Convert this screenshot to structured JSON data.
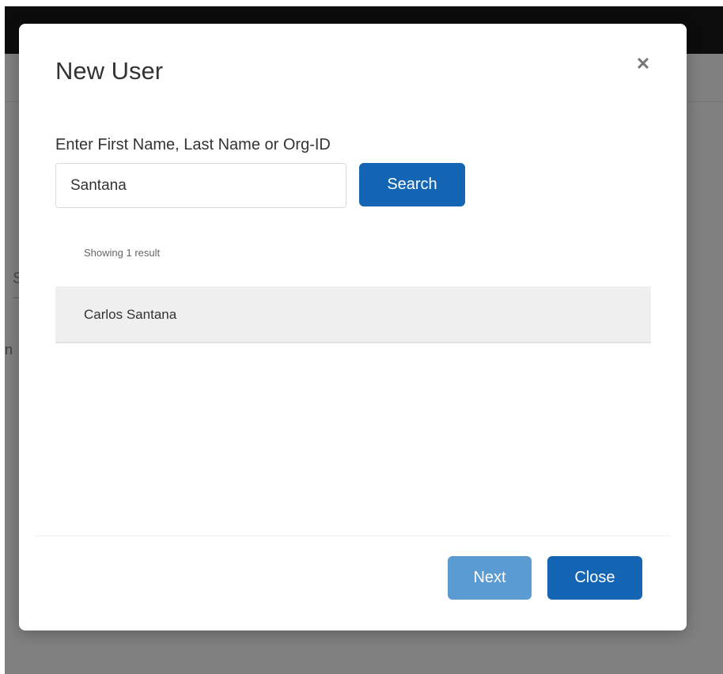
{
  "background": {
    "fragment_1": "S",
    "fragment_2": "n"
  },
  "modal": {
    "title": "New User",
    "close_icon": "close-icon",
    "search": {
      "label": "Enter First Name, Last Name or Org-ID",
      "value": "Santana",
      "button_label": "Search"
    },
    "results": {
      "count_text": "Showing 1 result",
      "items": [
        {
          "name": "Carlos Santana"
        }
      ]
    },
    "footer": {
      "next_label": "Next",
      "close_label": "Close"
    }
  },
  "colors": {
    "primary": "#1565b5",
    "primary_disabled": "#5a9bd1",
    "backdrop": "#808080",
    "topbar": "#0c0c0c"
  }
}
